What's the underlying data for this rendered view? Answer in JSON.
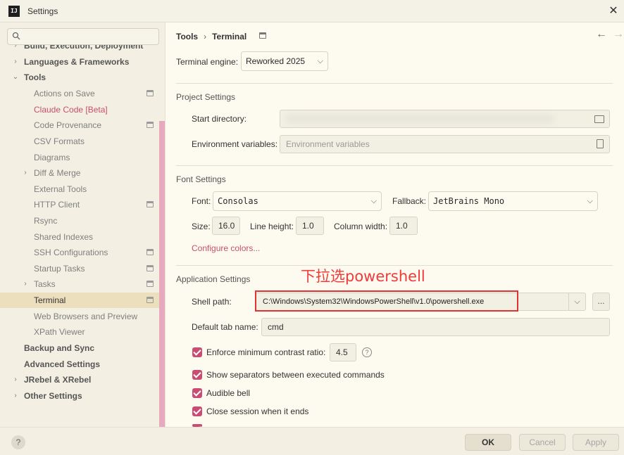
{
  "window": {
    "title": "Settings",
    "app_icon": "IJ"
  },
  "search": {
    "placeholder": ""
  },
  "sidebar": {
    "items": [
      {
        "label": "Build, Execution, Deployment",
        "level": 0,
        "chevron": "›"
      },
      {
        "label": "Languages & Frameworks",
        "level": 0,
        "chevron": "›"
      },
      {
        "label": "Tools",
        "level": 0,
        "chevron": "⌄"
      },
      {
        "label": "Actions on Save",
        "level": 1
      },
      {
        "label": "Claude Code [Beta]",
        "level": 1
      },
      {
        "label": "Code Provenance",
        "level": 1
      },
      {
        "label": "CSV Formats",
        "level": 1
      },
      {
        "label": "Diagrams",
        "level": 1
      },
      {
        "label": "Diff & Merge",
        "level": 1,
        "chevron": "›"
      },
      {
        "label": "External Tools",
        "level": 1
      },
      {
        "label": "HTTP Client",
        "level": 1
      },
      {
        "label": "Rsync",
        "level": 1
      },
      {
        "label": "Shared Indexes",
        "level": 1
      },
      {
        "label": "SSH Configurations",
        "level": 1
      },
      {
        "label": "Startup Tasks",
        "level": 1
      },
      {
        "label": "Tasks",
        "level": 1,
        "chevron": "›"
      },
      {
        "label": "Terminal",
        "level": 1,
        "selected": true
      },
      {
        "label": "Web Browsers and Preview",
        "level": 1
      },
      {
        "label": "XPath Viewer",
        "level": 1
      },
      {
        "label": "Backup and Sync",
        "level": 0
      },
      {
        "label": "Advanced Settings",
        "level": 0
      },
      {
        "label": "JRebel & XRebel",
        "level": 0,
        "chevron": "›"
      },
      {
        "label": "Other Settings",
        "level": 0,
        "chevron": "›"
      }
    ]
  },
  "breadcrumb": {
    "parent": "Tools",
    "separator": "›",
    "current": "Terminal"
  },
  "nav": {
    "back": "←",
    "forward": "→"
  },
  "engine": {
    "label": "Terminal engine:",
    "value": "Reworked 2025"
  },
  "project_settings": {
    "title": "Project Settings",
    "start_dir_label": "Start directory:",
    "env_label": "Environment variables:",
    "env_placeholder": "Environment variables"
  },
  "font_settings": {
    "title": "Font Settings",
    "font_label": "Font:",
    "font_value": "Consolas",
    "fallback_label": "Fallback:",
    "fallback_value": "JetBrains Mono",
    "size_label": "Size:",
    "size_value": "16.0",
    "line_height_label": "Line height:",
    "line_height_value": "1.0",
    "column_width_label": "Column width:",
    "column_width_value": "1.0",
    "configure_colors": "Configure colors..."
  },
  "app_settings": {
    "title": "Application Settings",
    "shell_label": "Shell path:",
    "shell_value": "C:\\Windows\\System32\\WindowsPowerShell\\v1.0\\powershell.exe",
    "shell_browse": "...",
    "default_tab_label": "Default tab name:",
    "default_tab_value": "cmd",
    "contrast_label": "Enforce minimum contrast ratio:",
    "contrast_value": "4.5",
    "separators_label": "Show separators between executed commands",
    "bell_label": "Audible bell",
    "close_session_label": "Close session when it ends"
  },
  "annotation": {
    "text": "下拉选powershell",
    "color": "#ef3b3b"
  },
  "footer": {
    "help": "?",
    "ok": "OK",
    "cancel": "Cancel",
    "apply": "Apply"
  },
  "colors": {
    "accent": "#c94d73",
    "selection": "#ecdfbd",
    "annotation": "#e03434"
  }
}
